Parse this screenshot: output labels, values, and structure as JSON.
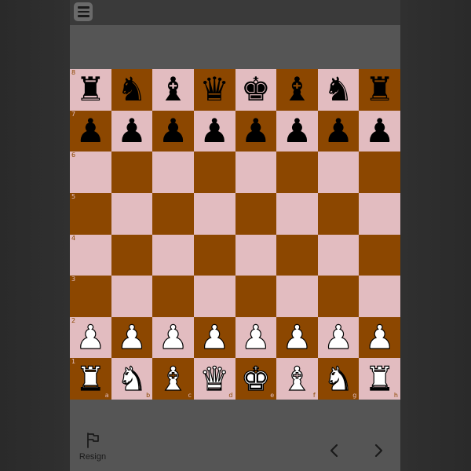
{
  "ui": {
    "menu_icon": "hamburger-menu-icon",
    "resign_label": "Resign",
    "resign_icon": "flag-icon",
    "prev_icon": "chevron-left-icon",
    "next_icon": "chevron-right-icon"
  },
  "colors": {
    "light_square": "#e2bcc0",
    "dark_square": "#8c4700",
    "panel": "#555555",
    "topbar": "#3a3a3a"
  },
  "board": {
    "ranks": [
      "8",
      "7",
      "6",
      "5",
      "4",
      "3",
      "2",
      "1"
    ],
    "files": [
      "a",
      "b",
      "c",
      "d",
      "e",
      "f",
      "g",
      "h"
    ],
    "position": [
      [
        "r",
        "n",
        "b",
        "q",
        "k",
        "b",
        "n",
        "r"
      ],
      [
        "p",
        "p",
        "p",
        "p",
        "p",
        "p",
        "p",
        "p"
      ],
      [
        "",
        "",
        "",
        "",
        "",
        "",
        "",
        ""
      ],
      [
        "",
        "",
        "",
        "",
        "",
        "",
        "",
        ""
      ],
      [
        "",
        "",
        "",
        "",
        "",
        "",
        "",
        ""
      ],
      [
        "",
        "",
        "",
        "",
        "",
        "",
        "",
        ""
      ],
      [
        "P",
        "P",
        "P",
        "P",
        "P",
        "P",
        "P",
        "P"
      ],
      [
        "R",
        "N",
        "B",
        "Q",
        "K",
        "B",
        "N",
        "R"
      ]
    ]
  }
}
